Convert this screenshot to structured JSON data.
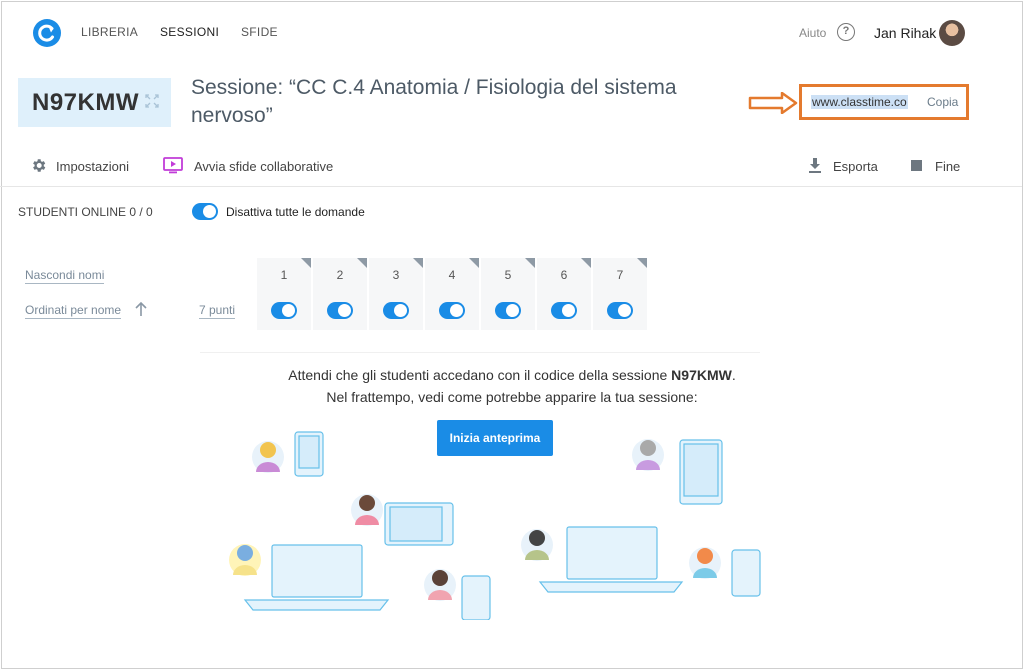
{
  "nav": {
    "items": [
      {
        "label": "LIBRERIA"
      },
      {
        "label": "SESSIONI"
      },
      {
        "label": "SFIDE"
      }
    ],
    "help_label": "Aiuto",
    "help_icon": "question-circle-icon",
    "user_name": "Jan Rihak"
  },
  "session": {
    "code": "N97KMW",
    "title": "Sessione: “CC C.4 Anatomia / Fisiologia del sistema nervoso”",
    "url": "www.classtime.co",
    "copy_label": "Copia"
  },
  "toolbar": {
    "settings_label": "Impostazioni",
    "collab_label": "Avvia sfide collaborative",
    "export_label": "Esporta",
    "end_label": "Fine"
  },
  "students": {
    "online_label": "STUDENTI ONLINE 0 / 0",
    "toggle_label": "Disattiva tutte le domande",
    "hide_names": "Nascondi nomi",
    "sort_label": "Ordinati per nome",
    "points_label": "7 punti"
  },
  "questions": [
    "1",
    "2",
    "3",
    "4",
    "5",
    "6",
    "7"
  ],
  "waiting": {
    "line1_prefix": "Attendi che gli studenti accedano con il codice della sessione ",
    "line1_code": "N97KMW",
    "line1_suffix": ".",
    "line2": "Nel frattempo, vedi come potrebbe apparire la tua sessione:",
    "preview_button": "Inizia anteprima"
  },
  "colors": {
    "accent": "#1a8ce6",
    "highlight_border": "#e47a2e",
    "code_bg": "#dff0fb"
  }
}
